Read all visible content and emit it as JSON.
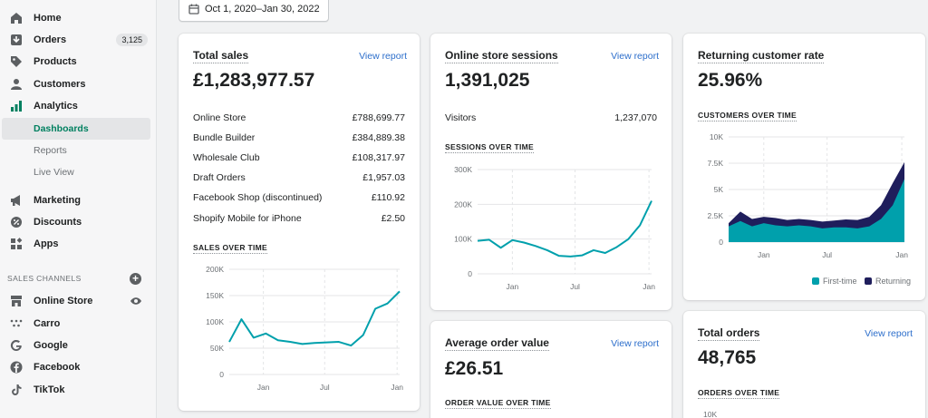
{
  "sidebar": {
    "items": [
      {
        "label": "Home",
        "icon": "home-icon"
      },
      {
        "label": "Orders",
        "icon": "orders-icon",
        "badge": "3,125"
      },
      {
        "label": "Products",
        "icon": "tag-icon"
      },
      {
        "label": "Customers",
        "icon": "person-icon"
      },
      {
        "label": "Analytics",
        "icon": "bar-chart-icon"
      }
    ],
    "analytics_sub": [
      {
        "label": "Dashboards",
        "active": true
      },
      {
        "label": "Reports",
        "active": false
      },
      {
        "label": "Live View",
        "active": false
      }
    ],
    "items2": [
      {
        "label": "Marketing",
        "icon": "megaphone-icon"
      },
      {
        "label": "Discounts",
        "icon": "discount-icon"
      },
      {
        "label": "Apps",
        "icon": "apps-icon"
      }
    ],
    "sales_channels_label": "SALES CHANNELS",
    "channels": [
      {
        "label": "Online Store",
        "icon": "store-icon"
      },
      {
        "label": "Carro",
        "icon": "carro-icon"
      },
      {
        "label": "Google",
        "icon": "google-icon"
      },
      {
        "label": "Facebook",
        "icon": "facebook-icon"
      },
      {
        "label": "TikTok",
        "icon": "tiktok-icon"
      }
    ]
  },
  "date_range": "Oct 1, 2020–Jan 30, 2022",
  "total_sales": {
    "title": "Total sales",
    "link": "View report",
    "value": "£1,283,977.57",
    "breakdown": [
      {
        "label": "Online Store",
        "value": "£788,699.77"
      },
      {
        "label": "Bundle Builder",
        "value": "£384,889.38"
      },
      {
        "label": "Wholesale Club",
        "value": "£108,317.97"
      },
      {
        "label": "Draft Orders",
        "value": "£1,957.03"
      },
      {
        "label": "Facebook Shop (discontinued)",
        "value": "£110.92"
      },
      {
        "label": "Shopify Mobile for iPhone",
        "value": "£2.50"
      }
    ],
    "chart_head": "SALES OVER TIME"
  },
  "sessions": {
    "title": "Online store sessions",
    "link": "View report",
    "value": "1,391,025",
    "visitors_label": "Visitors",
    "visitors_value": "1,237,070",
    "chart_head": "SESSIONS OVER TIME"
  },
  "returning": {
    "title": "Returning customer rate",
    "value": "25.96%",
    "chart_head": "CUSTOMERS OVER TIME"
  },
  "aov": {
    "title": "Average order value",
    "link": "View report",
    "value": "£26.51",
    "chart_head": "ORDER VALUE OVER TIME"
  },
  "total_orders": {
    "title": "Total orders",
    "link": "View report",
    "value": "48,765",
    "chart_head": "ORDERS OVER TIME",
    "partial_tick": "10K"
  },
  "colors": {
    "teal": "#00a0ac",
    "navy": "#1f1e5c",
    "link": "#2c6ecb",
    "active": "#008060"
  },
  "chart_data": [
    {
      "type": "line",
      "y_ticks": [
        "200K",
        "150K",
        "100K",
        "50K",
        "0"
      ],
      "x_ticks": [
        "Jan",
        "Jul",
        "Jan"
      ],
      "ylim": [
        0,
        200000
      ],
      "values": [
        62000,
        105000,
        70000,
        78000,
        65000,
        62000,
        58000,
        60000,
        61000,
        62000,
        55000,
        75000,
        125000,
        135000,
        158000
      ]
    },
    {
      "type": "line",
      "y_ticks": [
        "300K",
        "200K",
        "100K",
        "0"
      ],
      "x_ticks": [
        "Jan",
        "Jul",
        "Jan"
      ],
      "ylim": [
        0,
        300000
      ],
      "values": [
        95000,
        98000,
        75000,
        97000,
        90000,
        80000,
        68000,
        52000,
        50000,
        53000,
        68000,
        60000,
        77000,
        100000,
        140000,
        210000
      ]
    },
    {
      "type": "area",
      "y_ticks": [
        "10K",
        "7.5K",
        "5K",
        "2.5K",
        "0"
      ],
      "x_ticks": [
        "Jan",
        "Jul",
        "Jan"
      ],
      "ylim": [
        0,
        10000
      ],
      "legend": [
        "First-time",
        "Returning"
      ],
      "series": [
        {
          "name": "First-time",
          "values": [
            1500,
            2000,
            1500,
            1800,
            1600,
            1500,
            1600,
            1500,
            1300,
            1400,
            1400,
            1300,
            1500,
            2200,
            3500,
            6000
          ]
        },
        {
          "name": "Returning",
          "values": [
            1800,
            2900,
            2200,
            2400,
            2300,
            2100,
            2200,
            2100,
            1950,
            2050,
            2150,
            2100,
            2400,
            3500,
            5600,
            7600
          ]
        }
      ]
    }
  ]
}
